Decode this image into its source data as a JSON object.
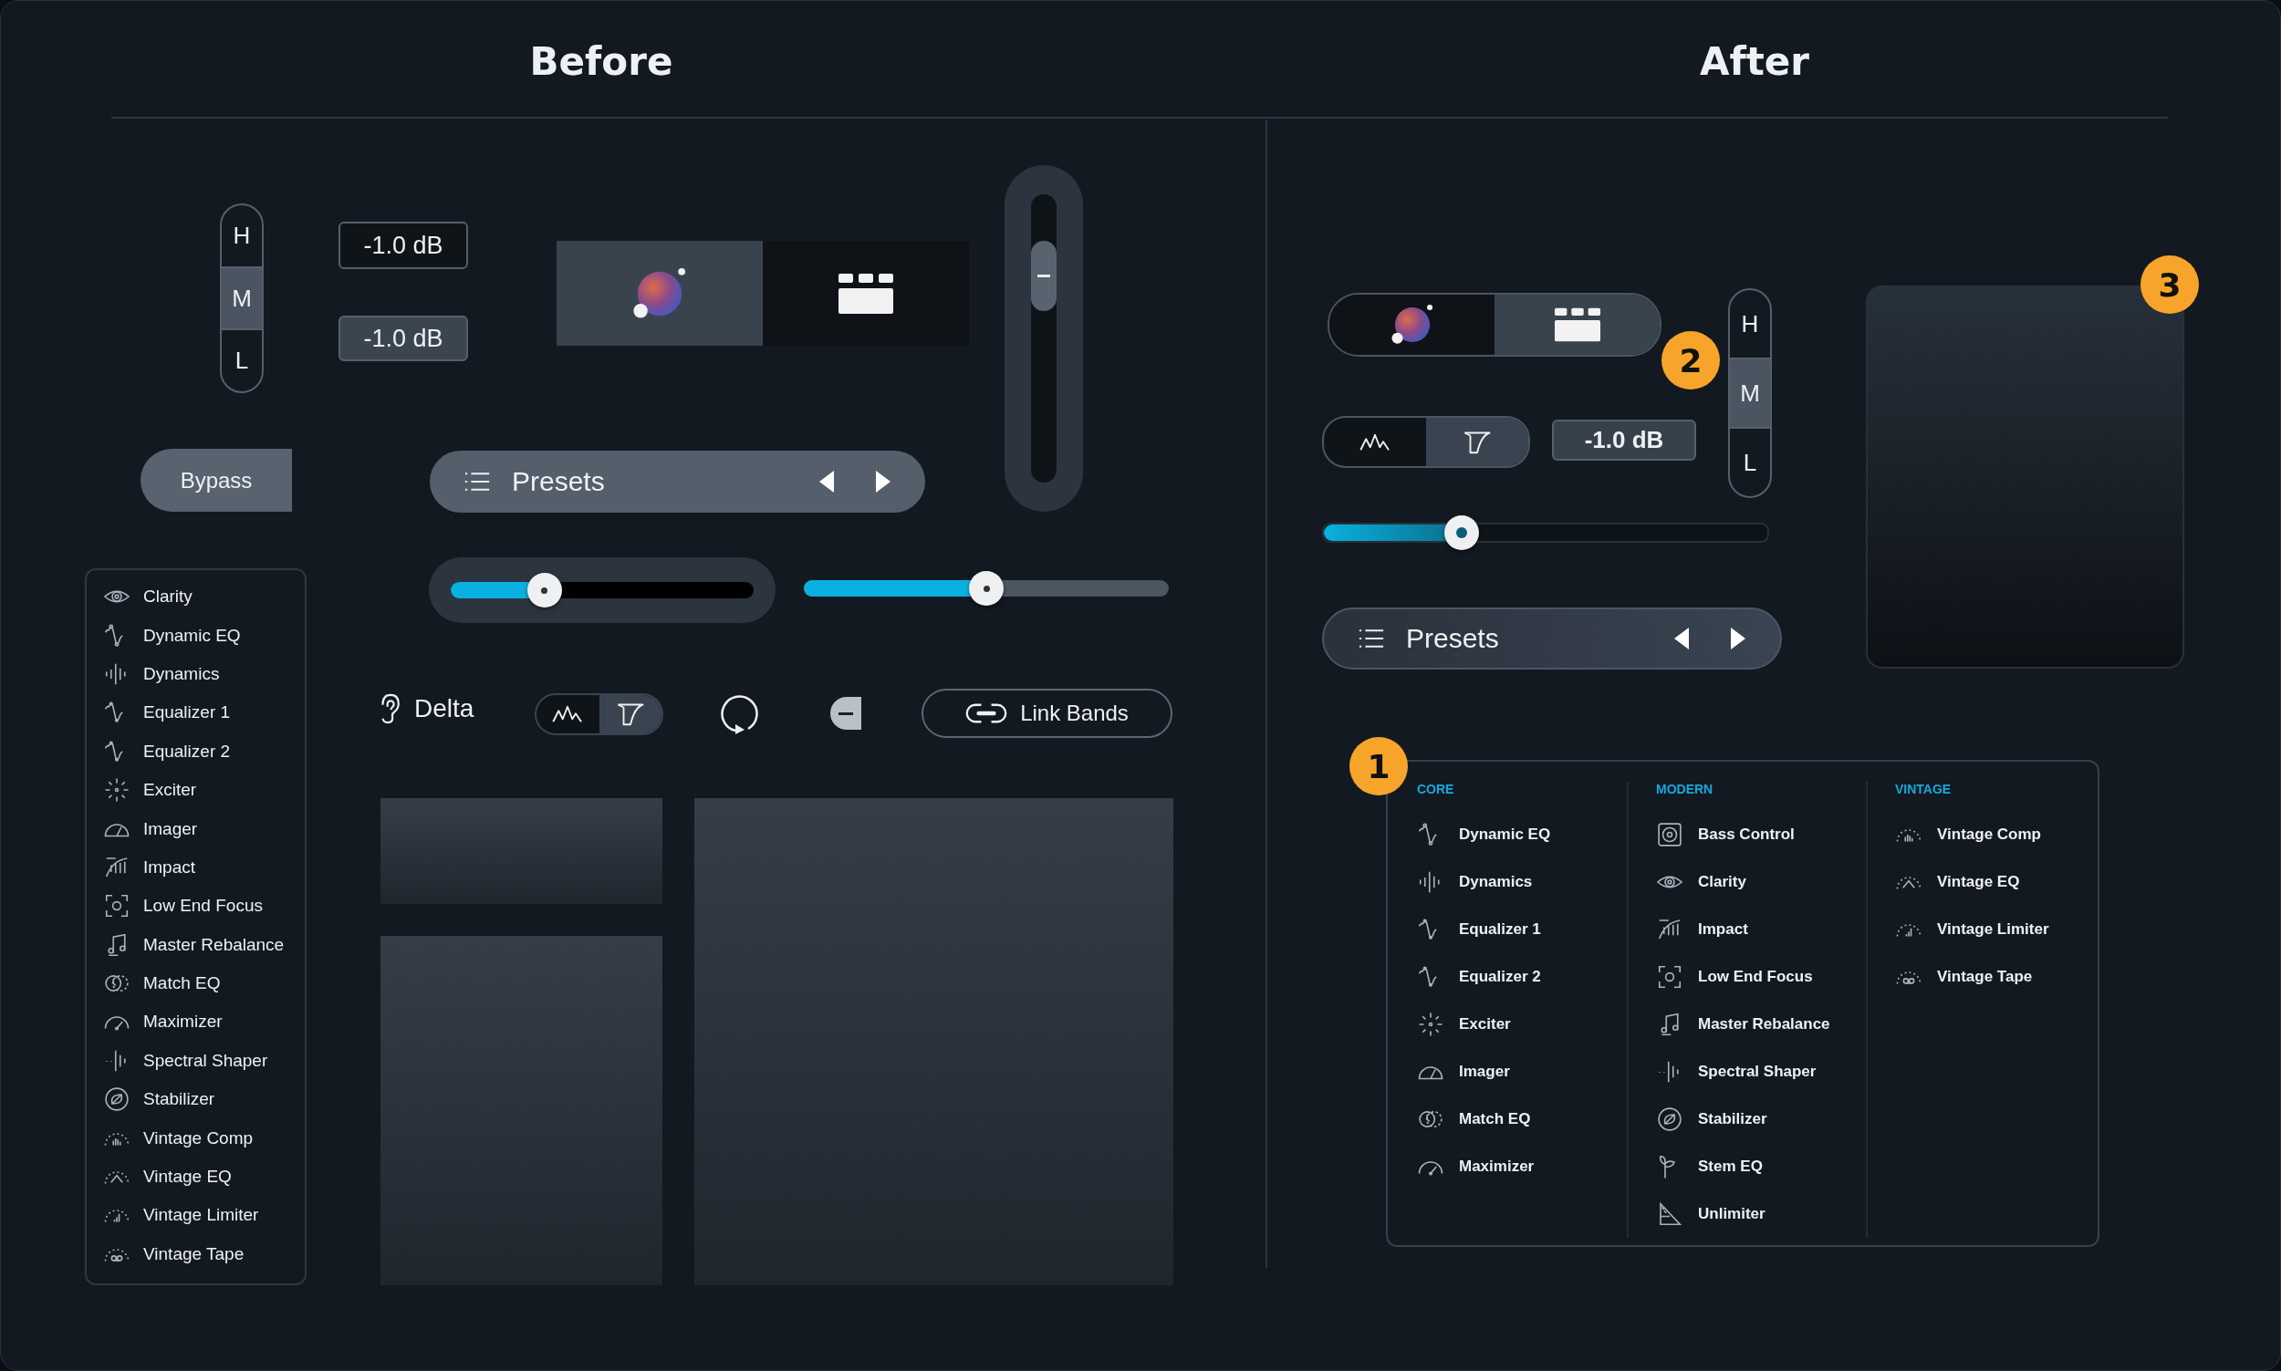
{
  "before": {
    "title": "Before",
    "band_selector": [
      {
        "label": "H",
        "selected": false
      },
      {
        "label": "M",
        "selected": true
      },
      {
        "label": "L",
        "selected": false
      }
    ],
    "gain_fields": [
      {
        "value": "-1.0 dB",
        "kind": "outlined"
      },
      {
        "value": "-1.0 dB",
        "kind": "filled"
      }
    ],
    "mode_toggle": [
      {
        "kind": "orb",
        "selected": true
      },
      {
        "kind": "blocks",
        "selected": false
      }
    ],
    "bypass": {
      "label": "Bypass"
    },
    "presets": {
      "label": "Presets"
    },
    "sliders": [
      {
        "kind": "inset",
        "level": 0.31
      },
      {
        "kind": "plain",
        "level": 0.5
      }
    ],
    "delta": {
      "label": "Delta"
    },
    "view_toggle": [
      {
        "kind": "peaks",
        "selected": false
      },
      {
        "kind": "filter",
        "selected": true
      }
    ],
    "link_bands": {
      "label": "Link Bands"
    },
    "modules": [
      {
        "label": "Clarity",
        "kind": "eye"
      },
      {
        "label": "Dynamic EQ",
        "kind": "node-curve"
      },
      {
        "label": "Dynamics",
        "kind": "bars"
      },
      {
        "label": "Equalizer 1",
        "kind": "curve"
      },
      {
        "label": "Equalizer 2",
        "kind": "curve"
      },
      {
        "label": "Exciter",
        "kind": "sparkle"
      },
      {
        "label": "Imager",
        "kind": "dial"
      },
      {
        "label": "Impact",
        "kind": "impact"
      },
      {
        "label": "Low End Focus",
        "kind": "focus"
      },
      {
        "label": "Master Rebalance",
        "kind": "note"
      },
      {
        "label": "Match EQ",
        "kind": "circles"
      },
      {
        "label": "Maximizer",
        "kind": "gauge"
      },
      {
        "label": "Spectral Shaper",
        "kind": "spectral"
      },
      {
        "label": "Stabilizer",
        "kind": "leaf"
      },
      {
        "label": "Vintage Comp",
        "kind": "arc-bars"
      },
      {
        "label": "Vintage EQ",
        "kind": "arc-peak"
      },
      {
        "label": "Vintage Limiter",
        "kind": "arc-meter"
      },
      {
        "label": "Vintage Tape",
        "kind": "arc-tape"
      }
    ]
  },
  "after": {
    "title": "After",
    "mode_toggle": [
      {
        "kind": "orb",
        "selected": false
      },
      {
        "kind": "blocks",
        "selected": true
      }
    ],
    "badges": [
      "1",
      "2",
      "3"
    ],
    "band_selector": [
      {
        "label": "H",
        "selected": false
      },
      {
        "label": "M",
        "selected": true
      },
      {
        "label": "L",
        "selected": false
      }
    ],
    "view_toggle": [
      {
        "kind": "peaks",
        "selected": false
      },
      {
        "kind": "filter",
        "selected": true
      }
    ],
    "gain_field": {
      "value": "-1.0 dB"
    },
    "slider": {
      "level": 0.31
    },
    "presets": {
      "label": "Presets"
    },
    "module_menu": [
      {
        "heading": "CORE",
        "items": [
          {
            "label": "Dynamic EQ",
            "kind": "node-curve"
          },
          {
            "label": "Dynamics",
            "kind": "bars"
          },
          {
            "label": "Equalizer 1",
            "kind": "curve"
          },
          {
            "label": "Equalizer 2",
            "kind": "curve"
          },
          {
            "label": "Exciter",
            "kind": "sparkle"
          },
          {
            "label": "Imager",
            "kind": "dial"
          },
          {
            "label": "Match EQ",
            "kind": "circles"
          },
          {
            "label": "Maximizer",
            "kind": "gauge"
          }
        ]
      },
      {
        "heading": "MODERN",
        "items": [
          {
            "label": "Bass Control",
            "kind": "speaker"
          },
          {
            "label": "Clarity",
            "kind": "eye"
          },
          {
            "label": "Impact",
            "kind": "impact"
          },
          {
            "label": "Low End Focus",
            "kind": "focus"
          },
          {
            "label": "Master Rebalance",
            "kind": "note"
          },
          {
            "label": "Spectral Shaper",
            "kind": "spectral"
          },
          {
            "label": "Stabilizer",
            "kind": "leaf"
          },
          {
            "label": "Stem EQ",
            "kind": "sprout"
          },
          {
            "label": "Unlimiter",
            "kind": "ramp"
          }
        ]
      },
      {
        "heading": "VINTAGE",
        "items": [
          {
            "label": "Vintage Comp",
            "kind": "arc-bars"
          },
          {
            "label": "Vintage EQ",
            "kind": "arc-peak"
          },
          {
            "label": "Vintage Limiter",
            "kind": "arc-meter"
          },
          {
            "label": "Vintage Tape",
            "kind": "arc-tape"
          }
        ]
      }
    ]
  }
}
